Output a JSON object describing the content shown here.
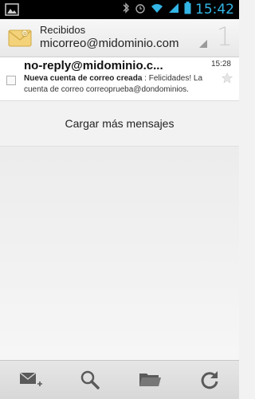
{
  "status_bar": {
    "clock": "15:42",
    "icons": [
      "bluetooth-icon",
      "alarm-icon",
      "wifi-icon",
      "signal-icon",
      "battery-icon"
    ]
  },
  "action_bar": {
    "folder": "Recibidos",
    "account": "micorreo@midominio.com",
    "unread_count": "1"
  },
  "messages": [
    {
      "sender": "no-reply@midominio.c...",
      "time": "15:28",
      "subject": "Nueva cuenta de correo creada",
      "preview": " : Felicidades! La cuenta de correo correoprueba@dondominios."
    }
  ],
  "load_more_label": "Cargar más mensajes",
  "bottom_bar": {
    "buttons": [
      "compose-icon",
      "search-icon",
      "folder-icon",
      "refresh-icon"
    ]
  },
  "colors": {
    "accent": "#33b5e5",
    "status_bar_bg": "#000000"
  }
}
